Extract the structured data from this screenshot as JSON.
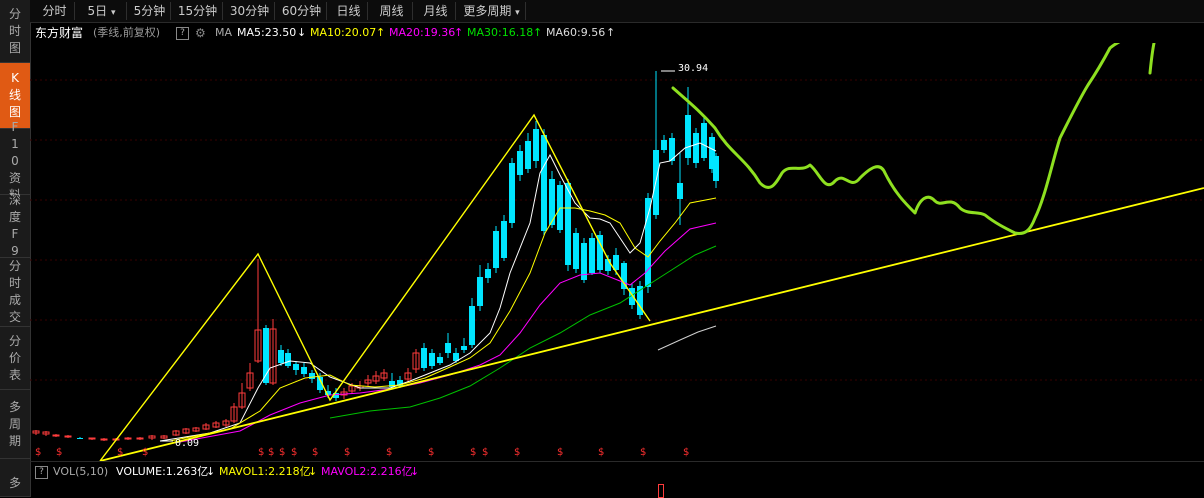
{
  "sidebar": {
    "tabs": [
      {
        "label": "分时图",
        "active": false
      },
      {
        "label": "K线图",
        "active": true
      },
      {
        "label": "F10资料",
        "active": false
      },
      {
        "label": "深度F9",
        "active": false
      },
      {
        "label": "分时成交",
        "active": false
      },
      {
        "label": "分价表",
        "active": false
      },
      {
        "label": "多周期",
        "active": false
      },
      {
        "label": "多",
        "active": false
      }
    ]
  },
  "period_bar": {
    "buttons": [
      "分时",
      "5日",
      "5分钟",
      "15分钟",
      "30分钟",
      "60分钟",
      "日线",
      "周线",
      "月线",
      "更多周期"
    ],
    "dropdown_arrow": "▾"
  },
  "info": {
    "stock_name": "东方财富",
    "mode": "(季线,前复权)",
    "help": "?",
    "gear": "⚙",
    "ma_label": "MA",
    "ma5": "MA5:23.50",
    "ma5_arrow": "↓",
    "ma10": "MA10:20.07",
    "ma10_arrow": "↑",
    "ma20": "MA20:19.36",
    "ma20_arrow": "↑",
    "ma30": "MA30:16.18",
    "ma30_arrow": "↑",
    "ma60": "MA60:9.56",
    "ma60_arrow": "↑"
  },
  "chart": {
    "high_label": "30.94",
    "low_label": "0.09",
    "dividend_marker": "$",
    "colors": {
      "up": "#ff3c3c",
      "down": "#00e5ff",
      "ma5": "#ffffff",
      "ma10": "#ffff00",
      "ma20": "#ff00ff",
      "ma30": "#00c000",
      "ma60": "#d0d0d0",
      "trendline": "#ffff00",
      "annotation": "#8ee020",
      "grid": "#3a0000"
    }
  },
  "volume": {
    "help": "?",
    "label": "VOL(5,10)",
    "volume": "VOLUME:1.263亿",
    "volume_arrow": "↓",
    "mavol1": "MAVOL1:2.218亿",
    "mavol1_arrow": "↓",
    "mavol2": "MAVOL2:2.216亿",
    "mavol2_arrow": "↓"
  }
}
